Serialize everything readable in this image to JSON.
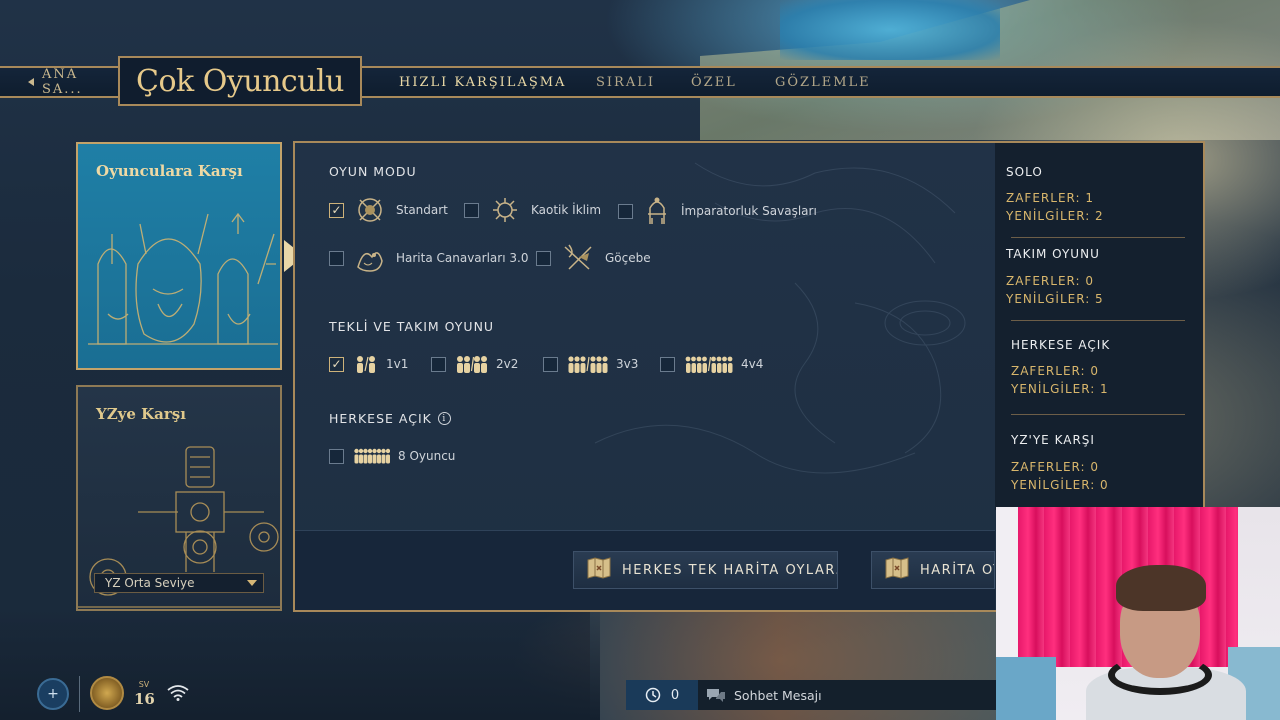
{
  "nav": {
    "back_label": "ANA SA...",
    "title": "Çok Oyunculu",
    "tabs": [
      {
        "label": "HIZLI KARŞILAŞMA",
        "active": true
      },
      {
        "label": "SIRALI",
        "active": false
      },
      {
        "label": "ÖZEL",
        "active": false
      },
      {
        "label": "GÖZLEMLE",
        "active": false
      }
    ]
  },
  "modes": {
    "pvp_title": "Oyunculara Karşı",
    "ai_title": "YZye Karşı",
    "ai_difficulty": "YZ Orta Seviye"
  },
  "game_mode": {
    "label": "OYUN MODU",
    "options": [
      {
        "label": "Standart",
        "checked": true,
        "icon": "standard-shield-icon"
      },
      {
        "label": "Kaotik İklim",
        "checked": false,
        "icon": "chaotic-climate-icon"
      },
      {
        "label": "İmparatorluk Savaşları",
        "checked": false,
        "icon": "empire-throne-icon"
      },
      {
        "label": "Harita Canavarları 3.0",
        "checked": false,
        "icon": "map-monster-icon"
      },
      {
        "label": "Göçebe",
        "checked": false,
        "icon": "nomad-weapons-icon"
      }
    ]
  },
  "team": {
    "label": "TEKLİ VE TAKIM OYUNU",
    "options": [
      {
        "label": "1v1",
        "checked": true
      },
      {
        "label": "2v2",
        "checked": false
      },
      {
        "label": "3v3",
        "checked": false
      },
      {
        "label": "4v4",
        "checked": false
      }
    ]
  },
  "ffa": {
    "label": "HERKESE AÇIK",
    "option": {
      "label": "8 Oyuncu",
      "checked": false
    }
  },
  "stats": {
    "solo": {
      "title": "SOLO",
      "wins": "ZAFERLER: 1",
      "losses": "YENİLGİLER: 2"
    },
    "team": {
      "title": "TAKIM OYUNU",
      "wins": "ZAFERLER: 0",
      "losses": "YENİLGİLER: 5"
    },
    "ffa": {
      "title": "HERKESE AÇIK",
      "wins": "ZAFERLER: 0",
      "losses": "YENİLGİLER: 1"
    },
    "ai": {
      "title": "YZ'YE KARŞI",
      "wins": "ZAFERLER: 0",
      "losses": "YENİLGİLER: 0"
    }
  },
  "actions": {
    "vote_all": "HERKES TEK HARİTA OYLAR...",
    "vote_map": "HARİTA OYLA"
  },
  "bottom": {
    "level_label": "SV",
    "level_value": "16",
    "chat_count": "0",
    "chat_placeholder": "Sohbet Mesajı"
  },
  "colors": {
    "gold_border": "#a8895a",
    "gold_text": "#d8b66c",
    "panel_bg": "#213247",
    "active_card": "#1f7fa6"
  }
}
